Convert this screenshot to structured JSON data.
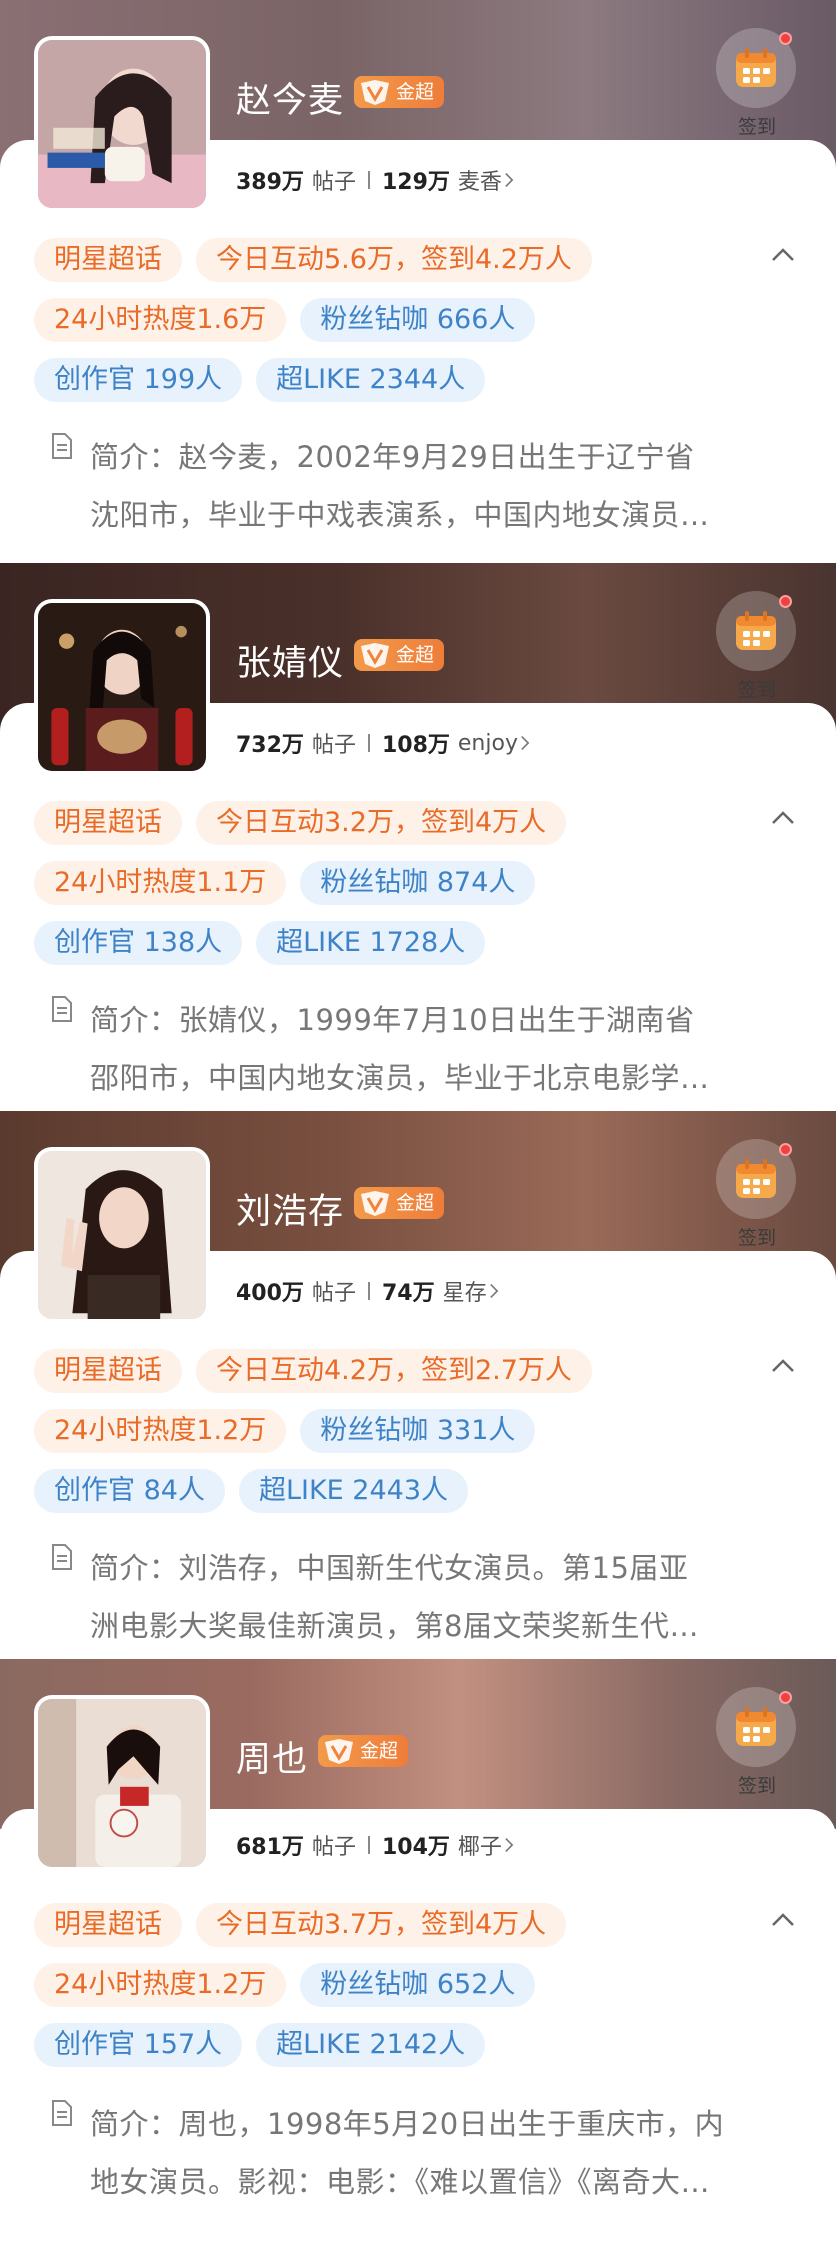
{
  "colors": {
    "tag_orange_bg": "#fdf1e8",
    "tag_orange_text": "#e96b28",
    "tag_blue_bg": "#e8f2fc",
    "tag_blue_text": "#3e83c7",
    "badge": "#ef843c",
    "notification_dot": "#f04141"
  },
  "cards": [
    {
      "name": "赵今麦",
      "badge": "金超",
      "checkin_label": "签到",
      "posts_count": "389万",
      "posts_label": "帖子",
      "fans_count": "129万",
      "fans_label": "麦香",
      "tags_row1": [
        "明星超话",
        "今日互动5.6万，签到4.2万人"
      ],
      "tags_row2": [
        "24小时热度1.6万",
        "粉丝钻咖 666人"
      ],
      "tags_row3": [
        "创作官 199人",
        "超LIKE 2344人"
      ],
      "intro_line1": "简介：赵今麦，2002年9月29日出生于辽宁省",
      "intro_line2": "沈阳市，毕业于中戏表演系，中国内地女演员…",
      "icons": [
        "level-badge-icon",
        "calendar-icon",
        "chevron-right-icon",
        "chevron-up-icon",
        "document-icon"
      ]
    },
    {
      "name": "张婧仪",
      "badge": "金超",
      "checkin_label": "签到",
      "posts_count": "732万",
      "posts_label": "帖子",
      "fans_count": "108万",
      "fans_label": "enjoy",
      "tags_row1": [
        "明星超话",
        "今日互动3.2万，签到4万人"
      ],
      "tags_row2": [
        "24小时热度1.1万",
        "粉丝钻咖 874人"
      ],
      "tags_row3": [
        "创作官 138人",
        "超LIKE 1728人"
      ],
      "intro_line1": "简介：张婧仪，1999年7月10日出生于湖南省",
      "intro_line2": "邵阳市，中国内地女演员，毕业于北京电影学…"
    },
    {
      "name": "刘浩存",
      "badge": "金超",
      "checkin_label": "签到",
      "posts_count": "400万",
      "posts_label": "帖子",
      "fans_count": "74万",
      "fans_label": "星存",
      "tags_row1": [
        "明星超话",
        "今日互动4.2万，签到2.7万人"
      ],
      "tags_row2": [
        "24小时热度1.2万",
        "粉丝钻咖 331人"
      ],
      "tags_row3": [
        "创作官 84人",
        "超LIKE 2443人"
      ],
      "intro_line1": "简介：刘浩存，中国新生代女演员。第15届亚",
      "intro_line2": "洲电影大奖最佳新演员，第8届文荣奖新生代…"
    },
    {
      "name": "周也",
      "badge": "金超",
      "checkin_label": "签到",
      "posts_count": "681万",
      "posts_label": "帖子",
      "fans_count": "104万",
      "fans_label": "椰子",
      "tags_row1": [
        "明星超话",
        "今日互动3.7万，签到4万人"
      ],
      "tags_row2": [
        "24小时热度1.2万",
        "粉丝钻咖 652人"
      ],
      "tags_row3": [
        "创作官 157人",
        "超LIKE 2142人"
      ],
      "intro_line1": "简介：周也，1998年5月20日出生于重庆市，内",
      "intro_line2": "地女演员。影视：电影：《难以置信》《离奇大…"
    }
  ]
}
